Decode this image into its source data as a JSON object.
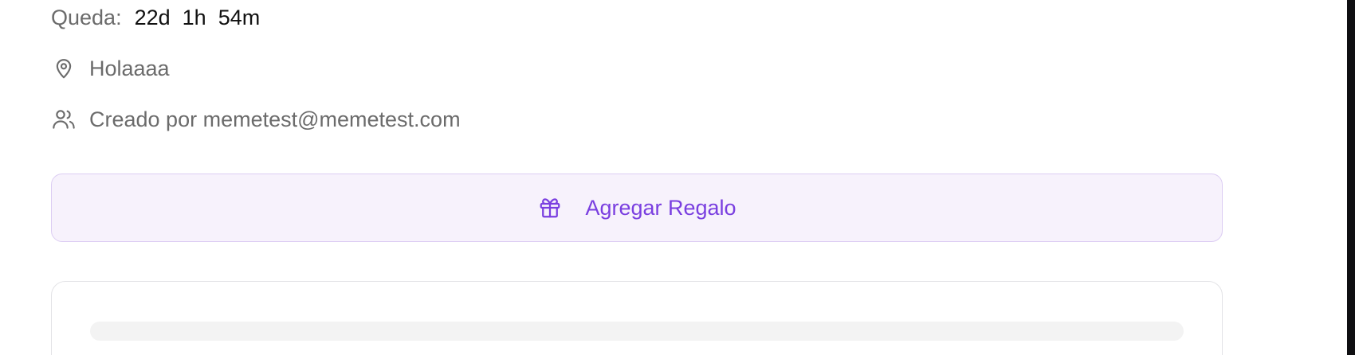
{
  "event": {
    "countdown": {
      "label": "Queda:",
      "days": "22d",
      "hours": "1h",
      "minutes": "54m"
    },
    "location": {
      "icon": "map-pin-icon",
      "text": "Holaaaa"
    },
    "creator": {
      "icon": "users-icon",
      "text": "Creado por memetest@memetest.com"
    }
  },
  "actions": {
    "add_gift": {
      "icon": "gift-icon",
      "label": "Agregar Regalo"
    }
  },
  "colors": {
    "accent": "#7a3fe0",
    "accent_bg": "#f7f2fc",
    "accent_border": "#dccdf3",
    "muted_text": "#6b6b6b",
    "skeleton": "#f3f3f3"
  }
}
